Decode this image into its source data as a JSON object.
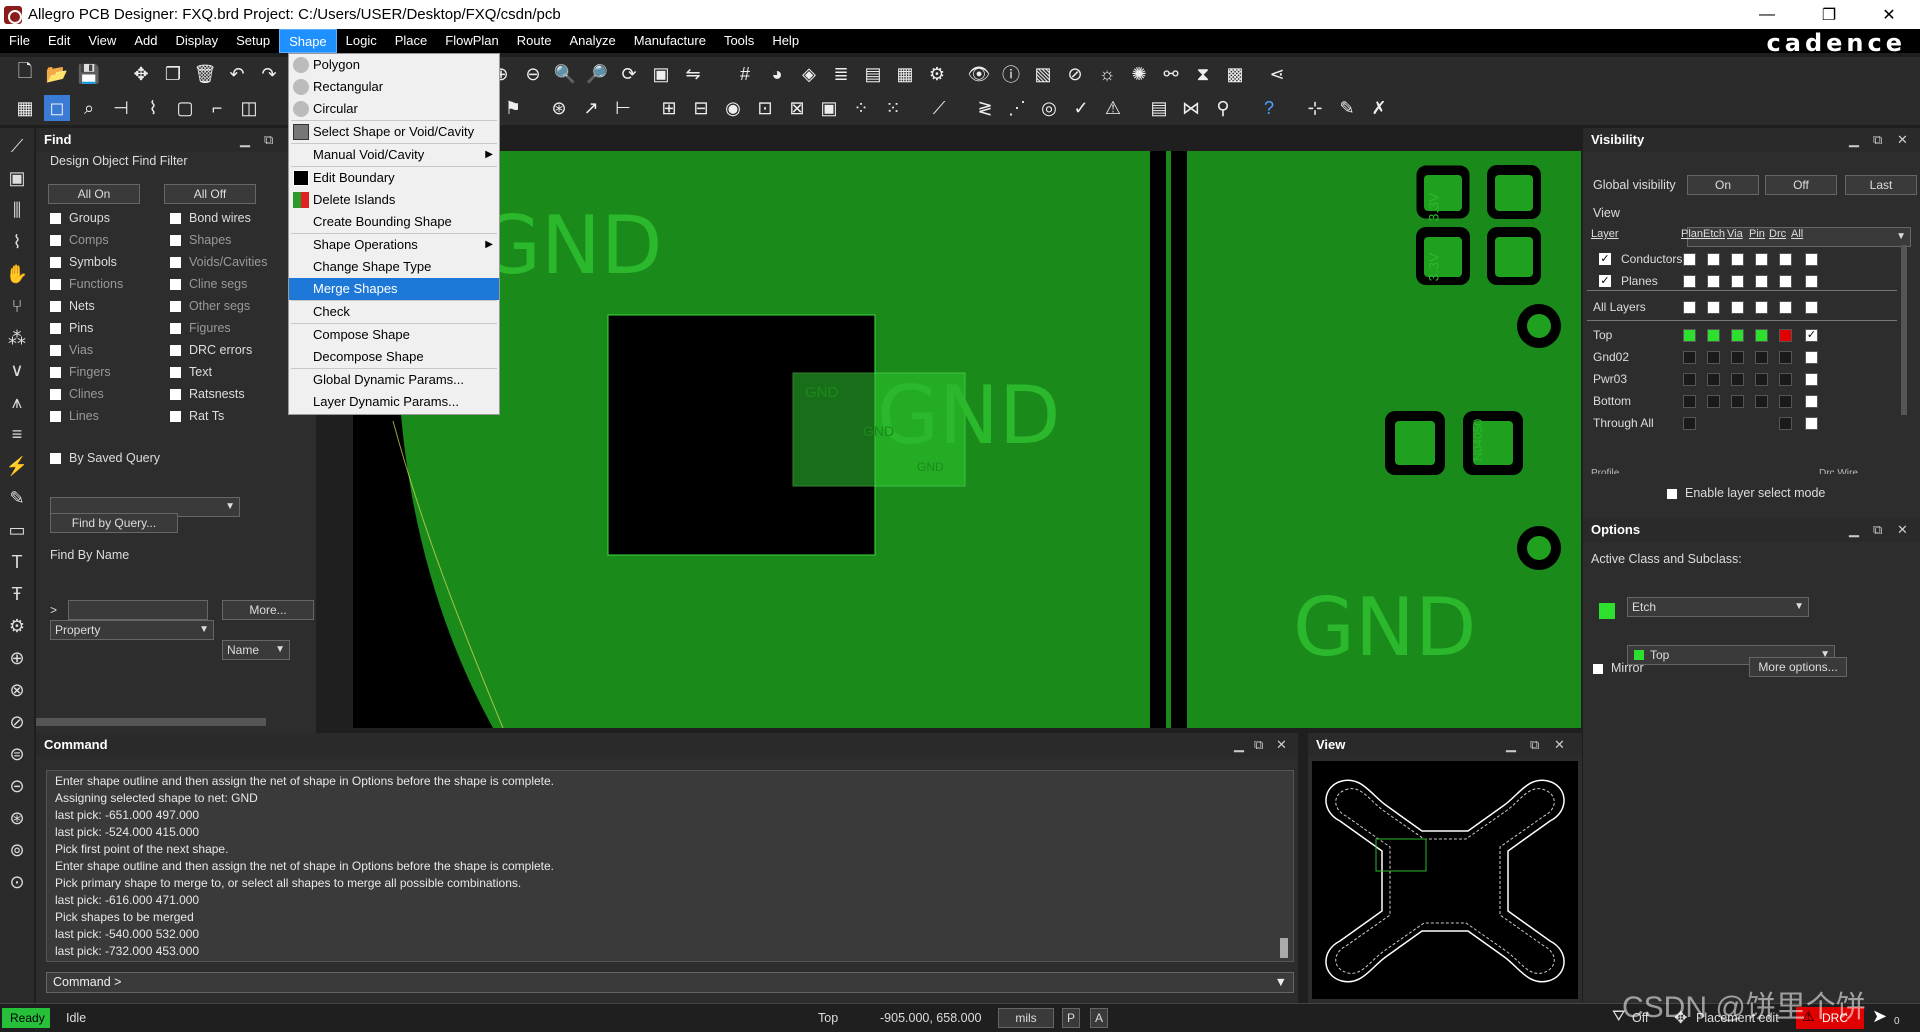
{
  "window": {
    "title": "Allegro PCB Designer: FXQ.brd  Project: C:/Users/USER/Desktop/FXQ/csdn/pcb"
  },
  "menubar": [
    "File",
    "Edit",
    "View",
    "Add",
    "Display",
    "Setup",
    "Shape",
    "Logic",
    "Place",
    "FlowPlan",
    "Route",
    "Analyze",
    "Manufacture",
    "Tools",
    "Help"
  ],
  "brand": "cadence",
  "shape_menu": {
    "items": [
      {
        "label": "Polygon"
      },
      {
        "label": "Rectangular"
      },
      {
        "label": "Circular"
      },
      {
        "label": "Select Shape or Void/Cavity"
      },
      {
        "label": "Manual Void/Cavity"
      },
      {
        "label": "Edit Boundary"
      },
      {
        "label": "Delete Islands"
      },
      {
        "label": "Create Bounding Shape"
      },
      {
        "label": "Shape Operations"
      },
      {
        "label": "Change Shape Type"
      },
      {
        "label": "Merge Shapes"
      },
      {
        "label": "Check"
      },
      {
        "label": "Compose Shape"
      },
      {
        "label": "Decompose Shape"
      },
      {
        "label": "Global Dynamic Params..."
      },
      {
        "label": "Layer Dynamic Params..."
      }
    ],
    "selected": "Merge Shapes"
  },
  "find": {
    "title": "Find",
    "filter_title": "Design Object Find Filter",
    "all_on": "All On",
    "all_off": "All Off",
    "left_items": [
      "Groups",
      "Comps",
      "Symbols",
      "Functions",
      "Nets",
      "Pins",
      "Vias",
      "Fingers",
      "Clines",
      "Lines"
    ],
    "right_items": [
      "Bond wires",
      "Shapes",
      "Voids/Cavities",
      "Cline segs",
      "Other segs",
      "Figures",
      "DRC errors",
      "Text",
      "Ratsnests",
      "Rat Ts"
    ],
    "saved_query": "By Saved Query",
    "find_by_query": "Find by Query...",
    "find_by_name": "Find By Name",
    "property": "Property",
    "name": "Name",
    "prompt": ">",
    "more": "More..."
  },
  "canvas": {
    "labels": [
      "GND",
      "GND",
      "GND",
      "GND",
      "GND",
      "GND",
      "3.3V",
      "3.3V",
      "N04050"
    ]
  },
  "command": {
    "title": "Command",
    "lines": [
      "Enter shape outline and then assign the net of shape in Options before the shape is complete.",
      "Assigning selected shape to net: GND",
      "last pick:  -651.000 497.000",
      "last pick:  -524.000 415.000",
      "Pick first point of the next shape.",
      "Enter shape outline and then assign the net of shape in Options before the shape is complete.",
      "Pick primary shape to merge to, or select all shapes to merge all possible combinations.",
      "last pick:  -616.000 471.000",
      "Pick shapes to be merged",
      "last pick:  -540.000 532.000",
      "last pick:  -732.000 453.000"
    ],
    "input": "Command >"
  },
  "view": {
    "title": "View"
  },
  "visibility": {
    "title": "Visibility",
    "global_label": "Global visibility",
    "on": "On",
    "off": "Off",
    "last": "Last",
    "view_label": "View",
    "col_headers": [
      "Layer",
      "Plan",
      "Etch",
      "Via",
      "Pin",
      "Drc",
      "All"
    ],
    "conductors": "Conductors",
    "planes": "Planes",
    "all_layers": "All Layers",
    "layers": [
      "Top",
      "Gnd02",
      "Pwr03",
      "Bottom",
      "Through All"
    ],
    "profile_partial": "Profile",
    "drc_partial": "Drc Wire",
    "enable_layer": "Enable layer select mode"
  },
  "options": {
    "title": "Options",
    "active_label": "Active Class and Subclass:",
    "class": "Etch",
    "subclass": "Top",
    "mirror": "Mirror",
    "more_options": "More options..."
  },
  "status": {
    "ready": "Ready",
    "idle": "Idle",
    "layer": "Top",
    "coords": "-905.000, 658.000",
    "units": "mils",
    "p": "P",
    "a": "A",
    "filter": "Off",
    "mode": "Placement edit",
    "drc": "DRC",
    "drc_count": "0",
    "watermark": "CSDN @饼里个饼"
  },
  "colors": {
    "board_green": "#1a8a1a",
    "accent_blue": "#1e78d7",
    "drc_red": "#e00000",
    "ready_green": "#27c03a"
  }
}
